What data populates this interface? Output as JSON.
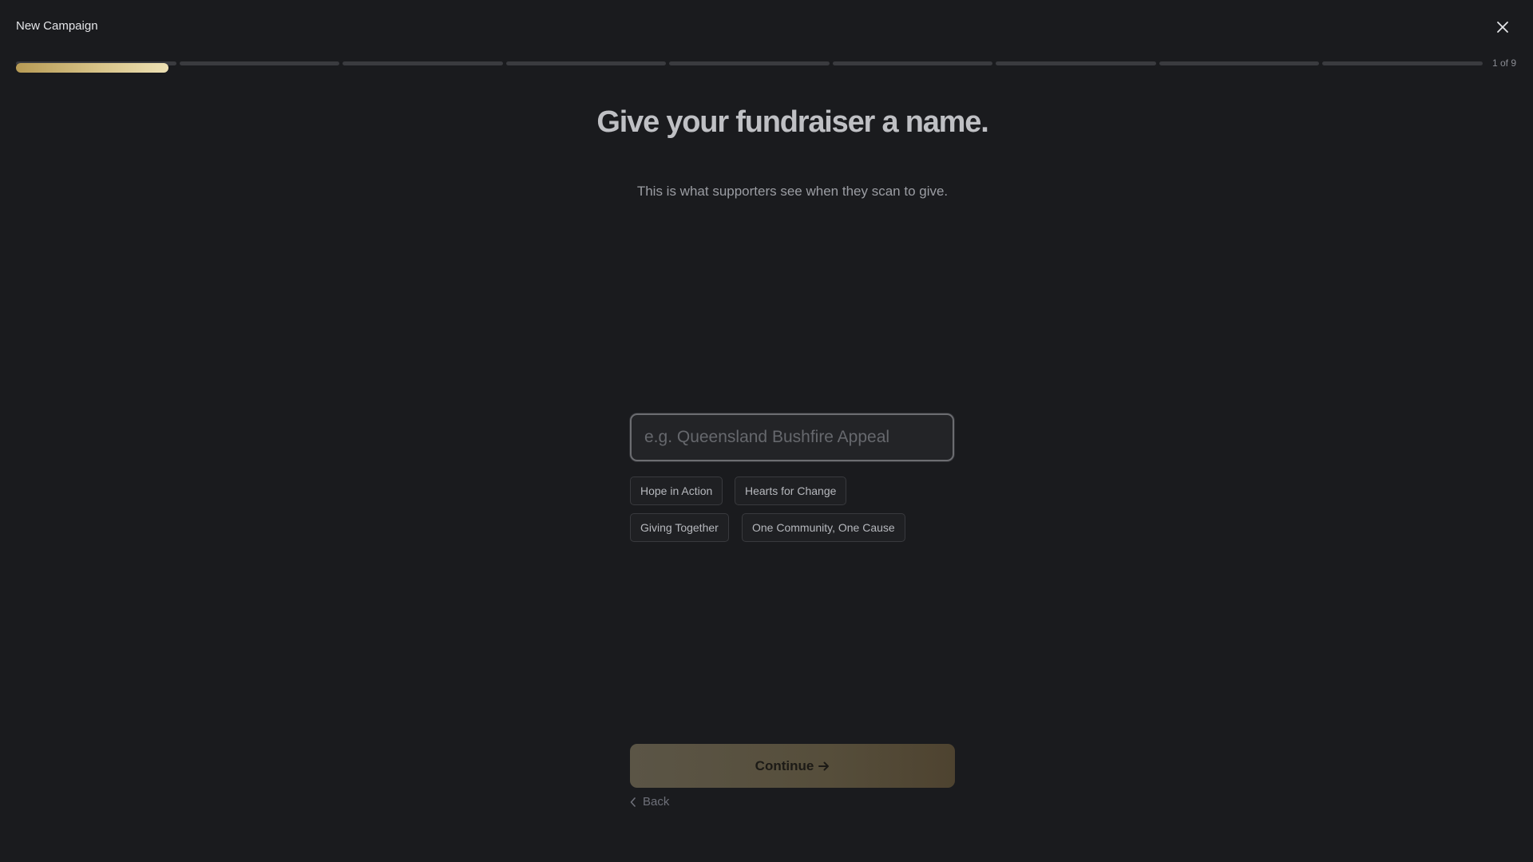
{
  "header": {
    "title": "New Campaign",
    "close_icon": "close-icon"
  },
  "progress": {
    "current_step": 1,
    "total_steps": 9,
    "step_fill_fraction": 0.95,
    "counter_text": "1 of 9",
    "accent_color": "#d8c489"
  },
  "main": {
    "heading": "Give your fundraiser a name.",
    "subheading": "This is what supporters see when they scan to give.",
    "name_input": {
      "value": "",
      "placeholder": "e.g. Queensland Bushfire Appeal"
    },
    "suggestions": [
      "Hope in Action",
      "Hearts for Change",
      "Giving Together",
      "One Community, One Cause"
    ]
  },
  "footer": {
    "continue_label": "Continue",
    "continue_icon": "arrow-right-icon",
    "back_label": "Back",
    "back_icon": "chevron-left-icon"
  }
}
